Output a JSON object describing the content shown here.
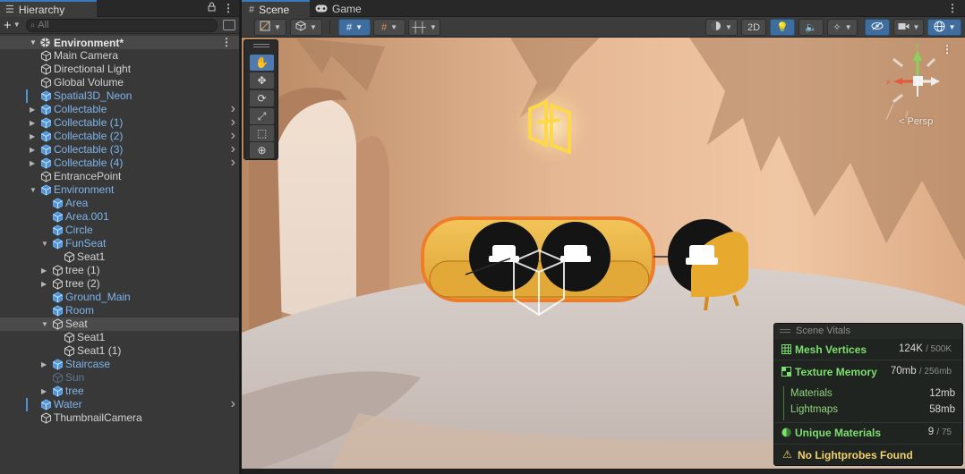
{
  "hierarchy": {
    "tab_label": "Hierarchy",
    "search_placeholder": "All",
    "scene_name": "Environment*",
    "items": [
      {
        "label": "Main Camera",
        "depth": 1,
        "kind": "plain",
        "expander": false,
        "prefab": false,
        "disabled": false,
        "go": false,
        "bar": false
      },
      {
        "label": "Directional Light",
        "depth": 1,
        "kind": "plain",
        "expander": false,
        "prefab": false,
        "disabled": false,
        "go": false,
        "bar": false
      },
      {
        "label": "Global Volume",
        "depth": 1,
        "kind": "plain",
        "expander": false,
        "prefab": false,
        "disabled": false,
        "go": false,
        "bar": false
      },
      {
        "label": "Spatial3D_Neon",
        "depth": 1,
        "kind": "prefab",
        "expander": false,
        "prefab": true,
        "disabled": false,
        "go": false,
        "bar": true
      },
      {
        "label": "Collectable",
        "depth": 1,
        "kind": "prefab",
        "expander": "collapsed",
        "prefab": true,
        "disabled": false,
        "go": true,
        "bar": false
      },
      {
        "label": "Collectable (1)",
        "depth": 1,
        "kind": "prefab",
        "expander": "collapsed",
        "prefab": true,
        "disabled": false,
        "go": true,
        "bar": false
      },
      {
        "label": "Collectable (2)",
        "depth": 1,
        "kind": "prefab",
        "expander": "collapsed",
        "prefab": true,
        "disabled": false,
        "go": true,
        "bar": false
      },
      {
        "label": "Collectable (3)",
        "depth": 1,
        "kind": "prefab",
        "expander": "collapsed",
        "prefab": true,
        "disabled": false,
        "go": true,
        "bar": false
      },
      {
        "label": "Collectable (4)",
        "depth": 1,
        "kind": "prefab",
        "expander": "collapsed",
        "prefab": true,
        "disabled": false,
        "go": true,
        "bar": false
      },
      {
        "label": "EntrancePoint",
        "depth": 1,
        "kind": "plain",
        "expander": false,
        "prefab": false,
        "disabled": false,
        "go": false,
        "bar": false
      },
      {
        "label": "Environment",
        "depth": 1,
        "kind": "prefab",
        "expander": "expanded",
        "prefab": true,
        "disabled": false,
        "go": false,
        "bar": false
      },
      {
        "label": "Area",
        "depth": 2,
        "kind": "prefab",
        "expander": false,
        "prefab": true,
        "disabled": false,
        "go": false,
        "bar": false
      },
      {
        "label": "Area.001",
        "depth": 2,
        "kind": "prefab",
        "expander": false,
        "prefab": true,
        "disabled": false,
        "go": false,
        "bar": false
      },
      {
        "label": "Circle",
        "depth": 2,
        "kind": "prefab",
        "expander": false,
        "prefab": true,
        "disabled": false,
        "go": false,
        "bar": false
      },
      {
        "label": "FunSeat",
        "depth": 2,
        "kind": "prefab",
        "expander": "expanded",
        "prefab": true,
        "disabled": false,
        "go": false,
        "bar": false
      },
      {
        "label": "Seat1",
        "depth": 3,
        "kind": "plain-special",
        "expander": false,
        "prefab": false,
        "disabled": false,
        "go": false,
        "bar": false
      },
      {
        "label": "tree (1)",
        "depth": 2,
        "kind": "plain-special",
        "expander": "collapsed",
        "prefab": false,
        "disabled": false,
        "go": false,
        "bar": false
      },
      {
        "label": "tree (2)",
        "depth": 2,
        "kind": "plain-special",
        "expander": "collapsed",
        "prefab": false,
        "disabled": false,
        "go": false,
        "bar": false
      },
      {
        "label": "Ground_Main",
        "depth": 2,
        "kind": "prefab",
        "expander": false,
        "prefab": true,
        "disabled": false,
        "go": false,
        "bar": false
      },
      {
        "label": "Room",
        "depth": 2,
        "kind": "prefab",
        "expander": false,
        "prefab": true,
        "disabled": false,
        "go": false,
        "bar": false
      },
      {
        "label": "Seat",
        "depth": 2,
        "kind": "plain",
        "expander": "expanded",
        "prefab": false,
        "disabled": false,
        "go": false,
        "bar": false,
        "highlight": true
      },
      {
        "label": "Seat1",
        "depth": 3,
        "kind": "plain-special",
        "expander": false,
        "prefab": false,
        "disabled": false,
        "go": false,
        "bar": false
      },
      {
        "label": "Seat1 (1)",
        "depth": 3,
        "kind": "plain-special",
        "expander": false,
        "prefab": false,
        "disabled": false,
        "go": false,
        "bar": false
      },
      {
        "label": "Staircase",
        "depth": 2,
        "kind": "prefab",
        "expander": "collapsed",
        "prefab": true,
        "disabled": false,
        "go": false,
        "bar": false
      },
      {
        "label": "Sun",
        "depth": 2,
        "kind": "disabled",
        "expander": false,
        "prefab": true,
        "disabled": true,
        "go": false,
        "bar": false
      },
      {
        "label": "tree",
        "depth": 2,
        "kind": "prefab",
        "expander": "collapsed",
        "prefab": true,
        "disabled": false,
        "go": false,
        "bar": false
      },
      {
        "label": "Water",
        "depth": 1,
        "kind": "prefab",
        "expander": false,
        "prefab": true,
        "disabled": false,
        "go": true,
        "bar": true
      },
      {
        "label": "ThumbnailCamera",
        "depth": 1,
        "kind": "plain",
        "expander": false,
        "prefab": false,
        "disabled": false,
        "go": false,
        "bar": false
      }
    ]
  },
  "scene": {
    "tabs": [
      {
        "label": "Scene",
        "icon": "hash-grid-icon",
        "active": true
      },
      {
        "label": "Game",
        "icon": "gamepad-icon",
        "active": false
      }
    ],
    "toolbar": {
      "two_d_label": "2D"
    },
    "tools": [
      "hand-tool",
      "move-tool",
      "rotate-tool",
      "scale-tool",
      "rect-tool",
      "transform-tool"
    ],
    "persp_label": "< Persp",
    "gizmo_axes": {
      "y": "y",
      "x": "x"
    }
  },
  "vitals": {
    "title": "Scene Vitals",
    "mesh_vertices": {
      "label": "Mesh Vertices",
      "value": "124K",
      "limit": "/ 500K"
    },
    "texture_memory": {
      "label": "Texture Memory",
      "value": "70mb",
      "limit": "/ 256mb"
    },
    "materials": {
      "label": "Materials",
      "value": "12mb"
    },
    "lightmaps": {
      "label": "Lightmaps",
      "value": "58mb"
    },
    "unique_materials": {
      "label": "Unique Materials",
      "value": "9",
      "limit": "/ 75"
    },
    "warning": {
      "label": "No Lightprobes Found"
    }
  },
  "colors": {
    "accent": "#3a79bb",
    "prefab_text": "#7fb4ea",
    "vitals_green": "#7ddf6d",
    "warning": "#f3d26a"
  }
}
